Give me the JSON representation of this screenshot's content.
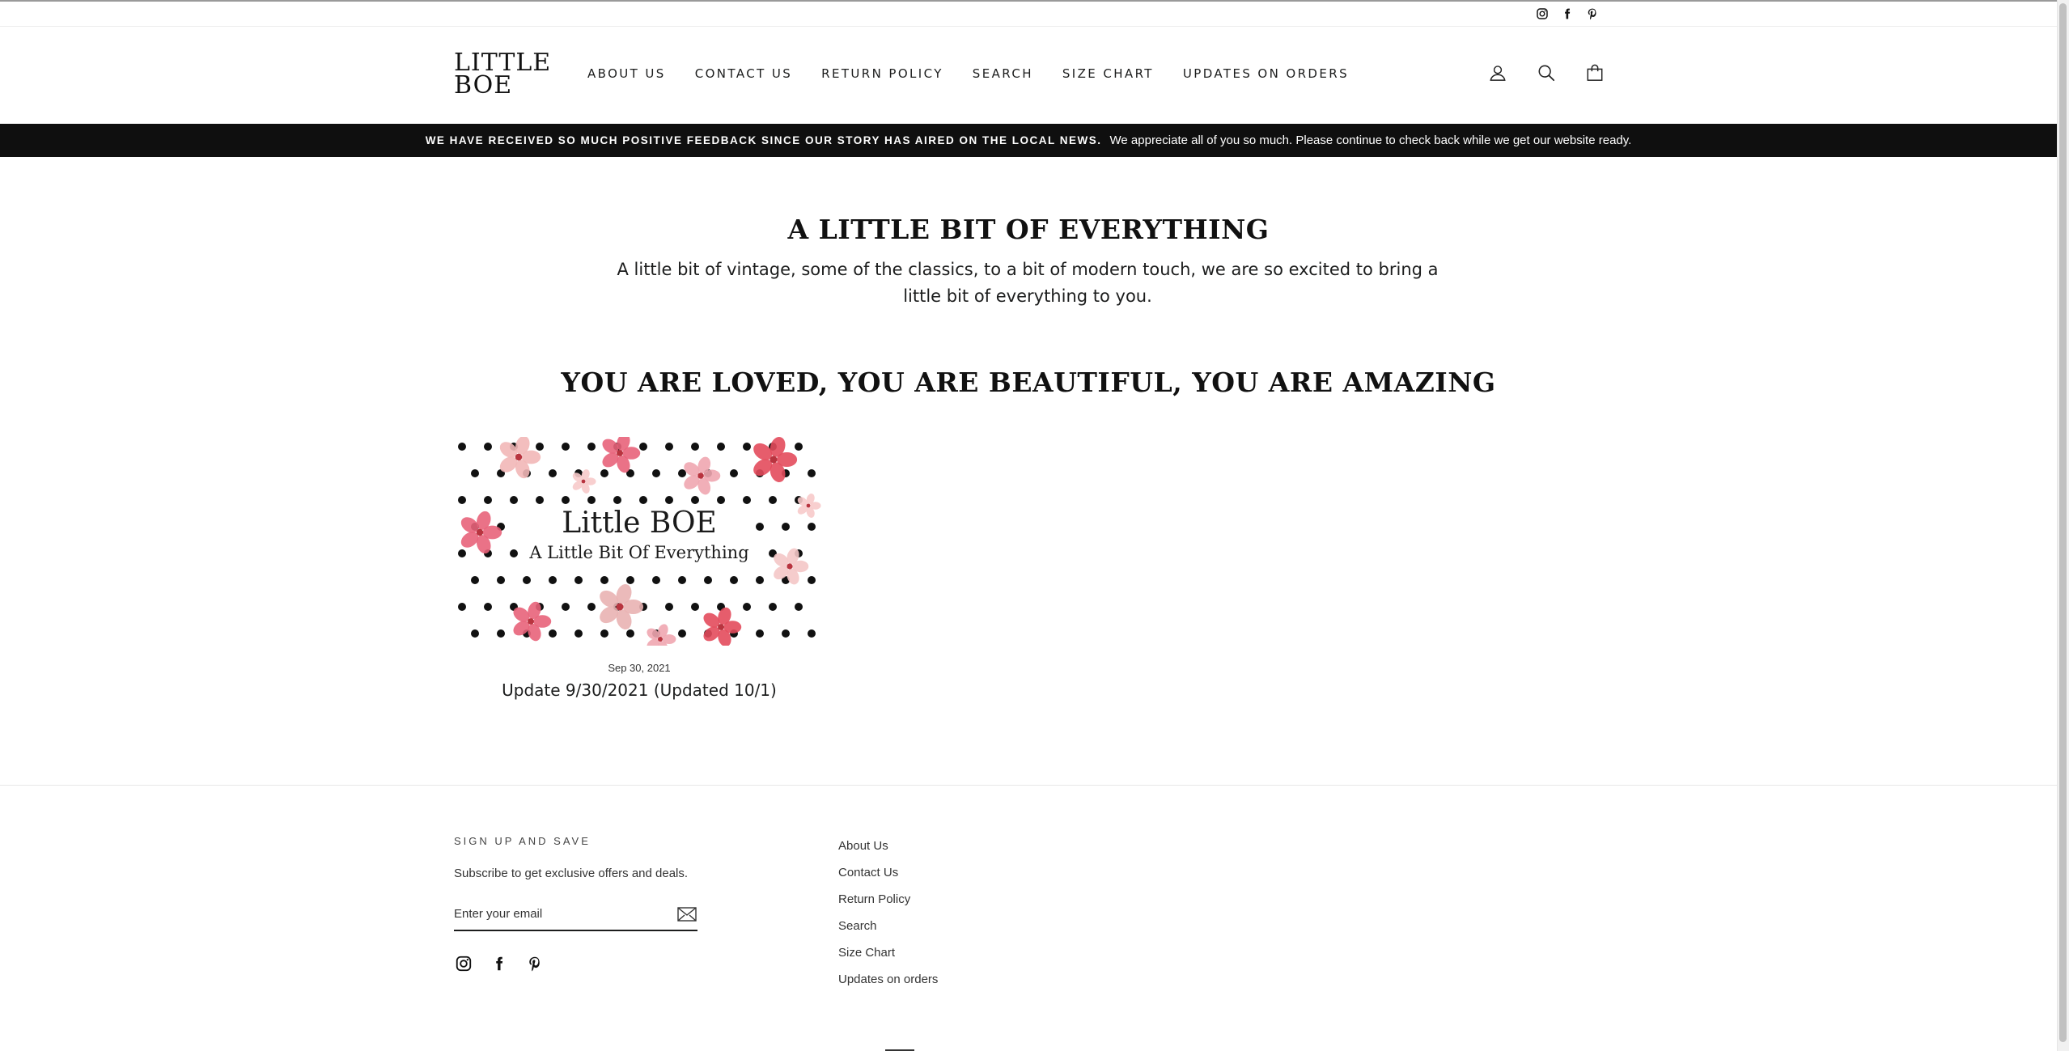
{
  "utility": {
    "social": [
      "instagram-icon",
      "facebook-icon",
      "pinterest-icon"
    ]
  },
  "header": {
    "logo_line1": "LITTLE",
    "logo_line2": "BOE",
    "nav": [
      {
        "label": "ABOUT US"
      },
      {
        "label": "CONTACT US"
      },
      {
        "label": "RETURN POLICY"
      },
      {
        "label": "SEARCH"
      },
      {
        "label": "SIZE CHART"
      },
      {
        "label": "UPDATES ON ORDERS"
      }
    ],
    "icons": [
      "account-icon",
      "search-icon",
      "cart-icon"
    ]
  },
  "announcement": {
    "strong": "WE HAVE RECEIVED SO MUCH POSITIVE FEEDBACK SINCE OUR STORY HAS AIRED ON THE LOCAL NEWS.",
    "text": "We appreciate all of you so much. Please continue to check back while we get our website ready."
  },
  "main": {
    "title": "A LITTLE BIT OF EVERYTHING",
    "intro": "A little bit of vintage, some of the classics, to a bit of modern touch, we are so excited to bring a little bit of everything to you.",
    "blog_title": "YOU ARE LOVED, YOU ARE BEAUTIFUL, YOU ARE AMAZING",
    "article": {
      "image_line1": "Little BOE",
      "image_line2": "A Little Bit Of Everything",
      "date": "Sep 30, 2021",
      "title": "Update 9/30/2021 (Updated 10/1)"
    }
  },
  "footer": {
    "heading": "SIGN UP AND SAVE",
    "subtext": "Subscribe to get exclusive offers and deals.",
    "email_placeholder": "Enter your email",
    "links": [
      {
        "label": "About Us"
      },
      {
        "label": "Contact Us"
      },
      {
        "label": "Return Policy"
      },
      {
        "label": "Search"
      },
      {
        "label": "Size Chart"
      },
      {
        "label": "Updates on orders"
      }
    ]
  },
  "colors": {
    "announcement_bg": "#0f0f0f",
    "text": "#1c1d1d",
    "accent_pink": "#e8637a"
  }
}
